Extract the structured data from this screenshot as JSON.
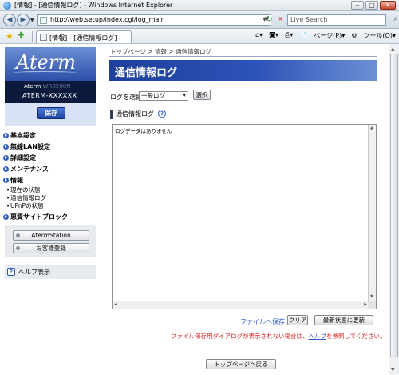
{
  "window": {
    "title": "[情報] - [通信情報ログ] - Windows Internet Explorer",
    "minimize": "‒",
    "maximize": "□",
    "close": "✕"
  },
  "navbar": {
    "url": "http://web.setup/index.cgi/log_main",
    "search_placeholder": "Live Search"
  },
  "favbar": {
    "tab_title": "[情報] - [通信情報ログ]",
    "page_menu": "ページ(P)",
    "tools_menu": "ツール(O)"
  },
  "sidebar": {
    "logo": "Aterm",
    "model_prefix": "Aterm",
    "model_hidden": "WR8500N",
    "model_name": "ATERM-XXXXXX",
    "save_label": "保存",
    "menu": [
      {
        "label": "基本設定"
      },
      {
        "label": "無線LAN設定"
      },
      {
        "label": "詳細設定"
      },
      {
        "label": "メンテナンス"
      }
    ],
    "info_label": "情報",
    "info_subs": [
      "現在の状態",
      "通信情報ログ",
      "UPnPの状態"
    ],
    "block_label": "悪質サイトブロック",
    "aterm_station": "AtermStation",
    "customer_reg": "お客様登録",
    "help_label": "ヘルプ表示"
  },
  "main": {
    "breadcrumb": "トップページ > 情報 > 通信情報ログ",
    "title": "通信情報ログ",
    "log_select_label": "ログを選択",
    "log_select_value": "一般ログ",
    "select_button": "選択",
    "section_title": "通信情報ログ",
    "log_text": "ログデータはありません",
    "save_link": "ファイルへ保存",
    "clear_button": "クリア",
    "refresh_button": "最新状態に更新",
    "warn_prefix": "ファイル保存用ダイアログが表示されない場合は、",
    "warn_link": "ヘルプ",
    "warn_suffix": "を参照してください。",
    "back_button": "トップページへ戻る"
  },
  "colors": {
    "header_blue": "#1d3f9c",
    "link_blue": "#2c55c6",
    "warn_red": "#d81c1c",
    "sidebar_dark": "#0b1a3c"
  }
}
